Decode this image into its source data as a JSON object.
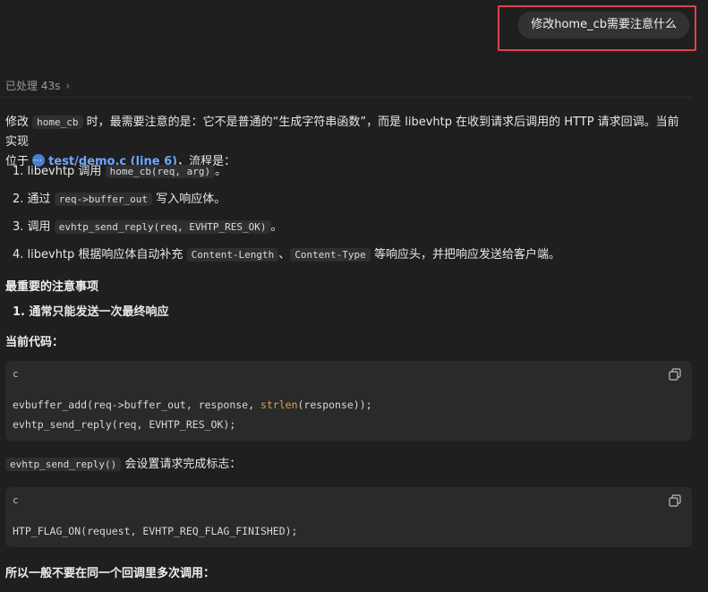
{
  "user_message": "修改home_cb需要注意什么",
  "processed": "已处理 43s",
  "intro": {
    "p1_a": "修改",
    "p1_code": "home_cb",
    "p1_b": "时，最需要注意的是：它不是普通的“生成字符串函数”，而是 libevhtp 在收到请求后调用的 HTTP 请求回调。当前实现",
    "p2_a": "位于",
    "link": "test/demo.c (line 6)",
    "p2_b": "，流程是："
  },
  "steps": [
    {
      "n": "1.",
      "a": "libevhtp 调用",
      "code": "home_cb(req, arg)",
      "b": "。"
    },
    {
      "n": "2.",
      "a": "通过",
      "code": "req->buffer_out",
      "b": "写入响应体。"
    },
    {
      "n": "3.",
      "a": "调用",
      "code": "evhtp_send_reply(req, EVHTP_RES_OK)",
      "b": "。"
    },
    {
      "n": "4.",
      "a": "libevhtp 根据响应体自动补充",
      "code": "Content-Length",
      "mid": "、",
      "code2": "Content-Type",
      "b": "等响应头，并把响应发送给客户端。"
    }
  ],
  "notes_heading": "最重要的注意事项",
  "note1": {
    "n": "1.",
    "text": "通常只能发送一次最终响应"
  },
  "current_code_label": "当前代码：",
  "code1": {
    "lang": "c",
    "line1_a": "evbuffer_add(req->buffer_out, response, ",
    "line1_kw": "strlen",
    "line1_b": "(response));",
    "line2": "evhtp_send_reply(req, EVHTP_RES_OK);"
  },
  "sentence2": {
    "code": "evhtp_send_reply()",
    "text": "会设置请求完成标志："
  },
  "code2": {
    "lang": "c",
    "line1": "HTP_FLAG_ON(request, EVHTP_REQ_FLAG_FINISHED);"
  },
  "final": "所以一般不要在同一个回调里多次调用："
}
